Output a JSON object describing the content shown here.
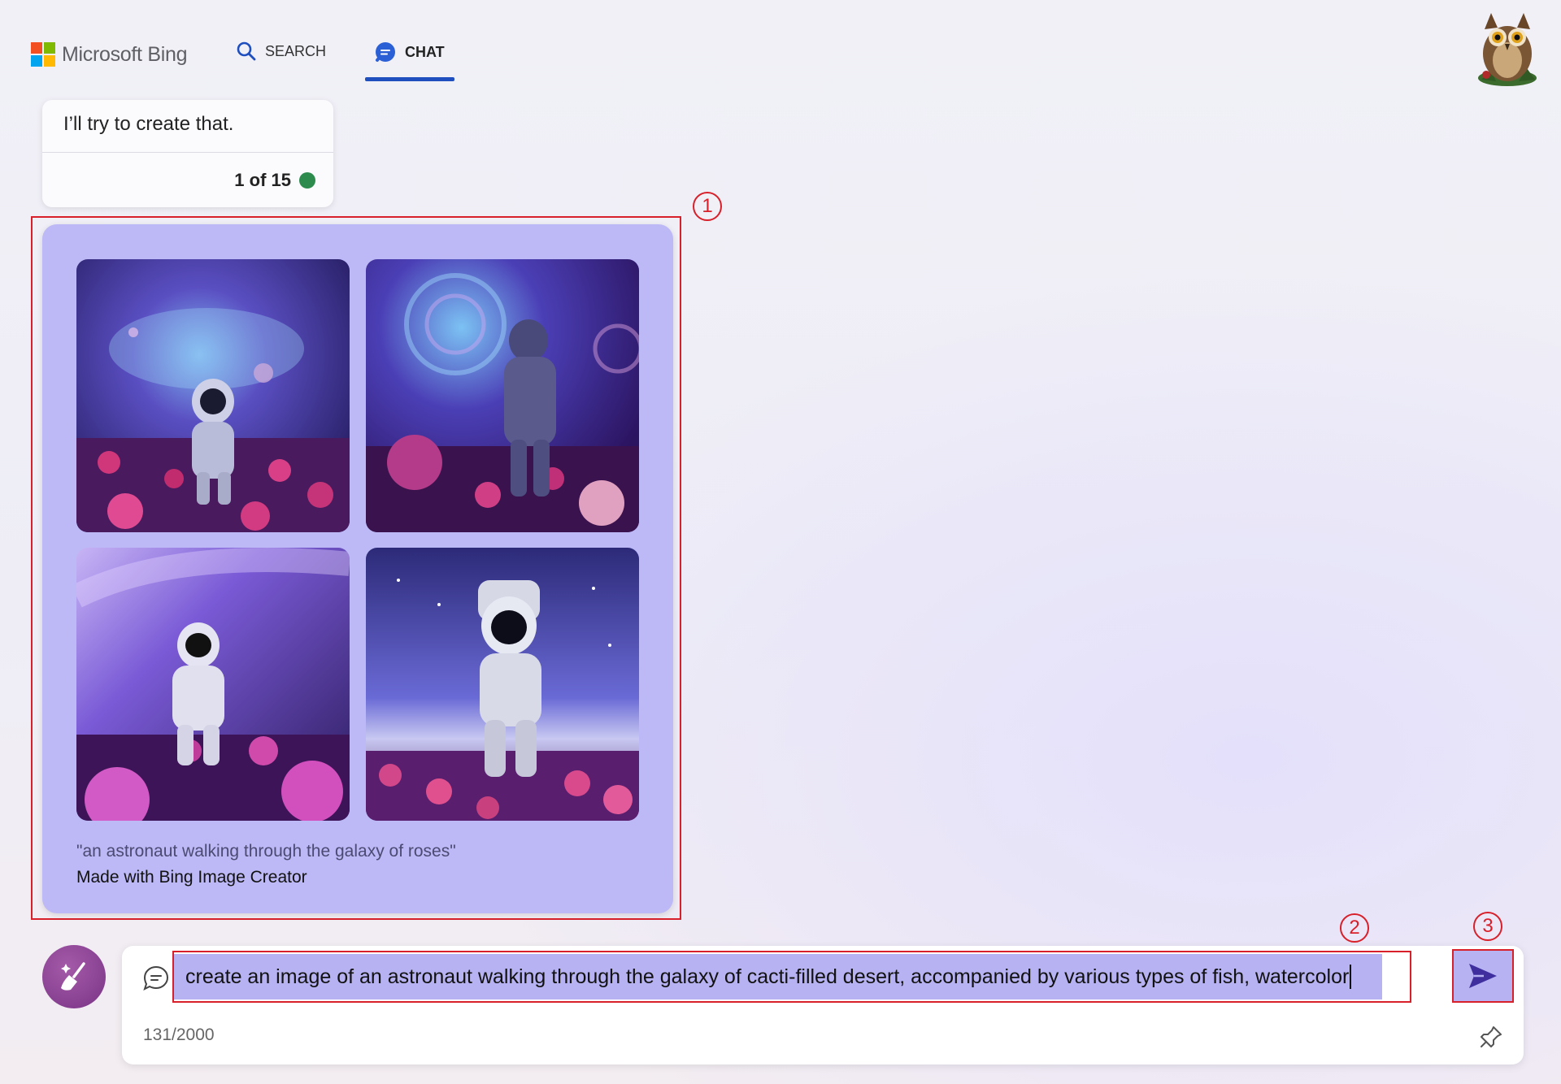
{
  "header": {
    "logo_text": "Microsoft Bing",
    "nav": {
      "search_label": "SEARCH",
      "chat_label": "CHAT"
    },
    "brand_colors": {
      "red": "#f25022",
      "green": "#7fba00",
      "blue": "#00a4ef",
      "yellow": "#ffb900",
      "accent": "#1f4fbf"
    }
  },
  "response": {
    "message": "I’ll try to create that.",
    "turn_count": "1 of 15",
    "status_color": "#2e8b4e"
  },
  "image_result": {
    "images": [
      {
        "label": "astronaut-roses-image-1"
      },
      {
        "label": "astronaut-roses-image-2"
      },
      {
        "label": "astronaut-roses-image-3"
      },
      {
        "label": "astronaut-roses-image-4"
      }
    ],
    "caption": "\"an astronaut walking through the galaxy of roses\"",
    "credit": "Made with Bing Image Creator"
  },
  "annotations": {
    "box1": "1",
    "box2": "2",
    "box3": "3",
    "color": "#d8202a"
  },
  "composer": {
    "input_value": "create an image of an astronaut walking through the galaxy of cacti-filled desert, accompanied by various types of fish, watercolor",
    "char_count": "131/2000",
    "icons": {
      "new_topic": "broom-icon",
      "mode": "chat-bubble-icon",
      "send": "send-icon",
      "pin": "pin-icon"
    }
  }
}
